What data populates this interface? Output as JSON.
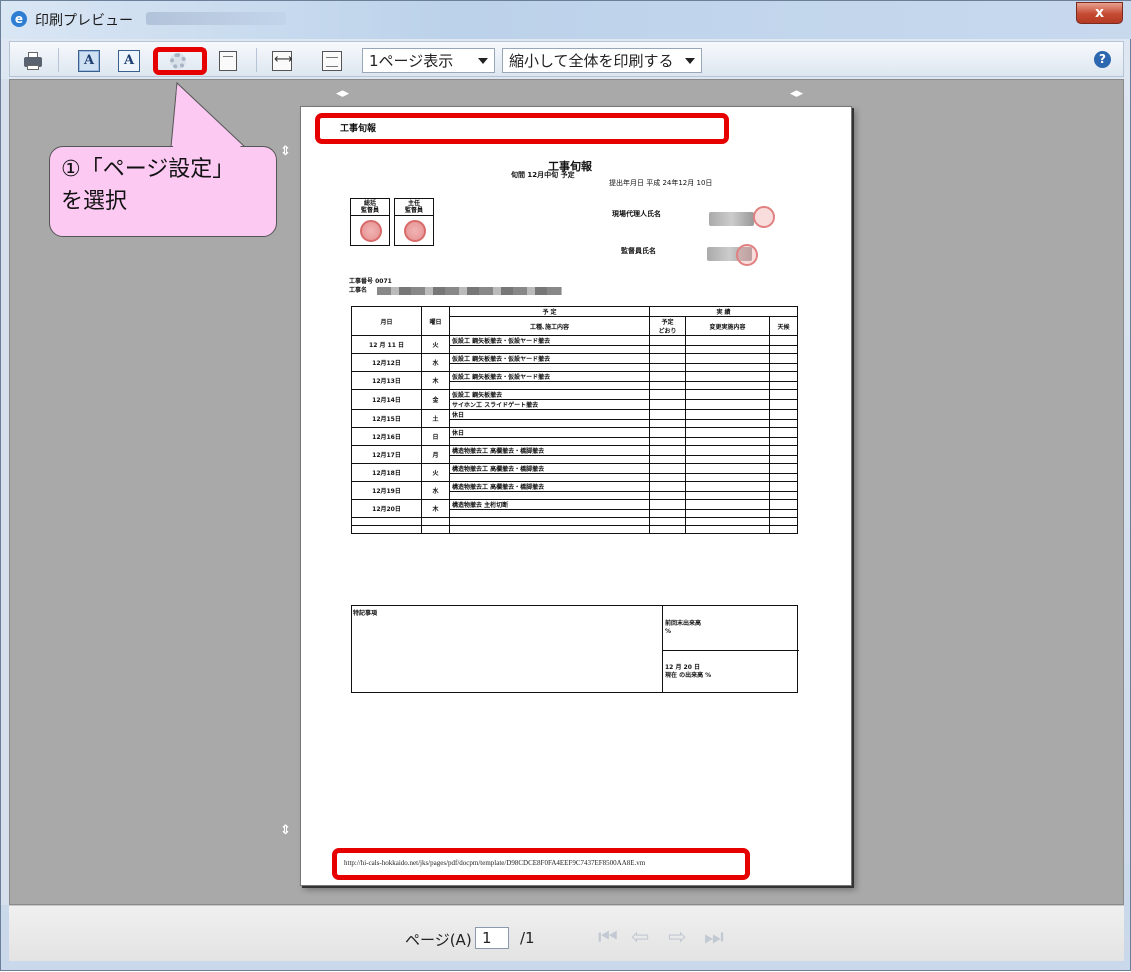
{
  "window": {
    "title": "印刷プレビュー",
    "close_label": "x"
  },
  "toolbar": {
    "icons": [
      "printer-icon",
      "portrait-icon",
      "landscape-icon",
      "page-setup-gear-icon",
      "full-page-icon",
      "page-width-icon",
      "shrink-to-fit-icon",
      "help-icon"
    ],
    "portrait_glyph": "A",
    "landscape_glyph": "A",
    "view_mode": "1ページ表示",
    "scale_mode": "縮小して全体を印刷する",
    "help_glyph": "?"
  },
  "annotation": {
    "callout_line1": "①「ページ設定」",
    "callout_line2": "を選択",
    "highlight_color": "#e60000",
    "callout_color": "#fbc9f2"
  },
  "document": {
    "header": "工事旬報",
    "title": "工事旬報",
    "subtitle": "旬間 12月中旬 予定",
    "submit_date": "提出年月日 平成 24年12月 10日",
    "inspectors": [
      "総括\n監督員",
      "主任\n監督員"
    ],
    "site_agent_label": "現場代理人氏名",
    "supervisor_label": "監督員氏名",
    "project_number": "工事番号 0071",
    "project_name_label": "工事名",
    "table": {
      "header_group_plan": "予 定",
      "header_group_actual": "実 績",
      "columns": [
        "月日",
        "曜日",
        "工種､施工内容",
        "予定\nどおり",
        "変更実施内容",
        "天候"
      ],
      "rows": [
        {
          "date": "12 月 11 日",
          "day": "火",
          "work": "仮設工 鋼矢板撤去・仮設ヤード撤去"
        },
        {
          "date": "12月12日",
          "day": "水",
          "work": "仮設工 鋼矢板撤去・仮設ヤード撤去"
        },
        {
          "date": "12月13日",
          "day": "木",
          "work": "仮設工 鋼矢板撤去・仮設ヤード撤去"
        },
        {
          "date": "12月14日",
          "day": "金",
          "work": "仮設工 鋼矢板撤去",
          "work2": "サイホン工 スライドゲート撤去"
        },
        {
          "date": "12月15日",
          "day": "土",
          "work": "休日"
        },
        {
          "date": "12月16日",
          "day": "日",
          "work": "休日"
        },
        {
          "date": "12月17日",
          "day": "月",
          "work": "構造物撤去工 高欄撤去・橋脚撤去"
        },
        {
          "date": "12月18日",
          "day": "火",
          "work": "構造物撤去工 高欄撤去・橋脚撤去"
        },
        {
          "date": "12月19日",
          "day": "水",
          "work": "構造物撤去工 高欄撤去・橋脚撤去"
        },
        {
          "date": "12月20日",
          "day": "木",
          "work": "構造物撤去 主桁切断"
        }
      ]
    },
    "remarks_label": "特記事項",
    "prev_progress_label": "前回末出来高",
    "prev_progress_unit": "%",
    "current_date": "12 月 20 日",
    "current_progress_label": "現在 の出来高 %",
    "footer_url": "http://hi-cals-hokkaido.net/jks/pages/pdf/docpm/template/D98CDCE8F0FA4EEF9C7437EF8500AA8E.vm"
  },
  "statusbar": {
    "page_label": "ページ(A)",
    "page_value": "1",
    "page_total": "/1",
    "nav_icons": [
      "first-page-icon",
      "prev-page-icon",
      "next-page-icon",
      "last-page-icon"
    ]
  }
}
